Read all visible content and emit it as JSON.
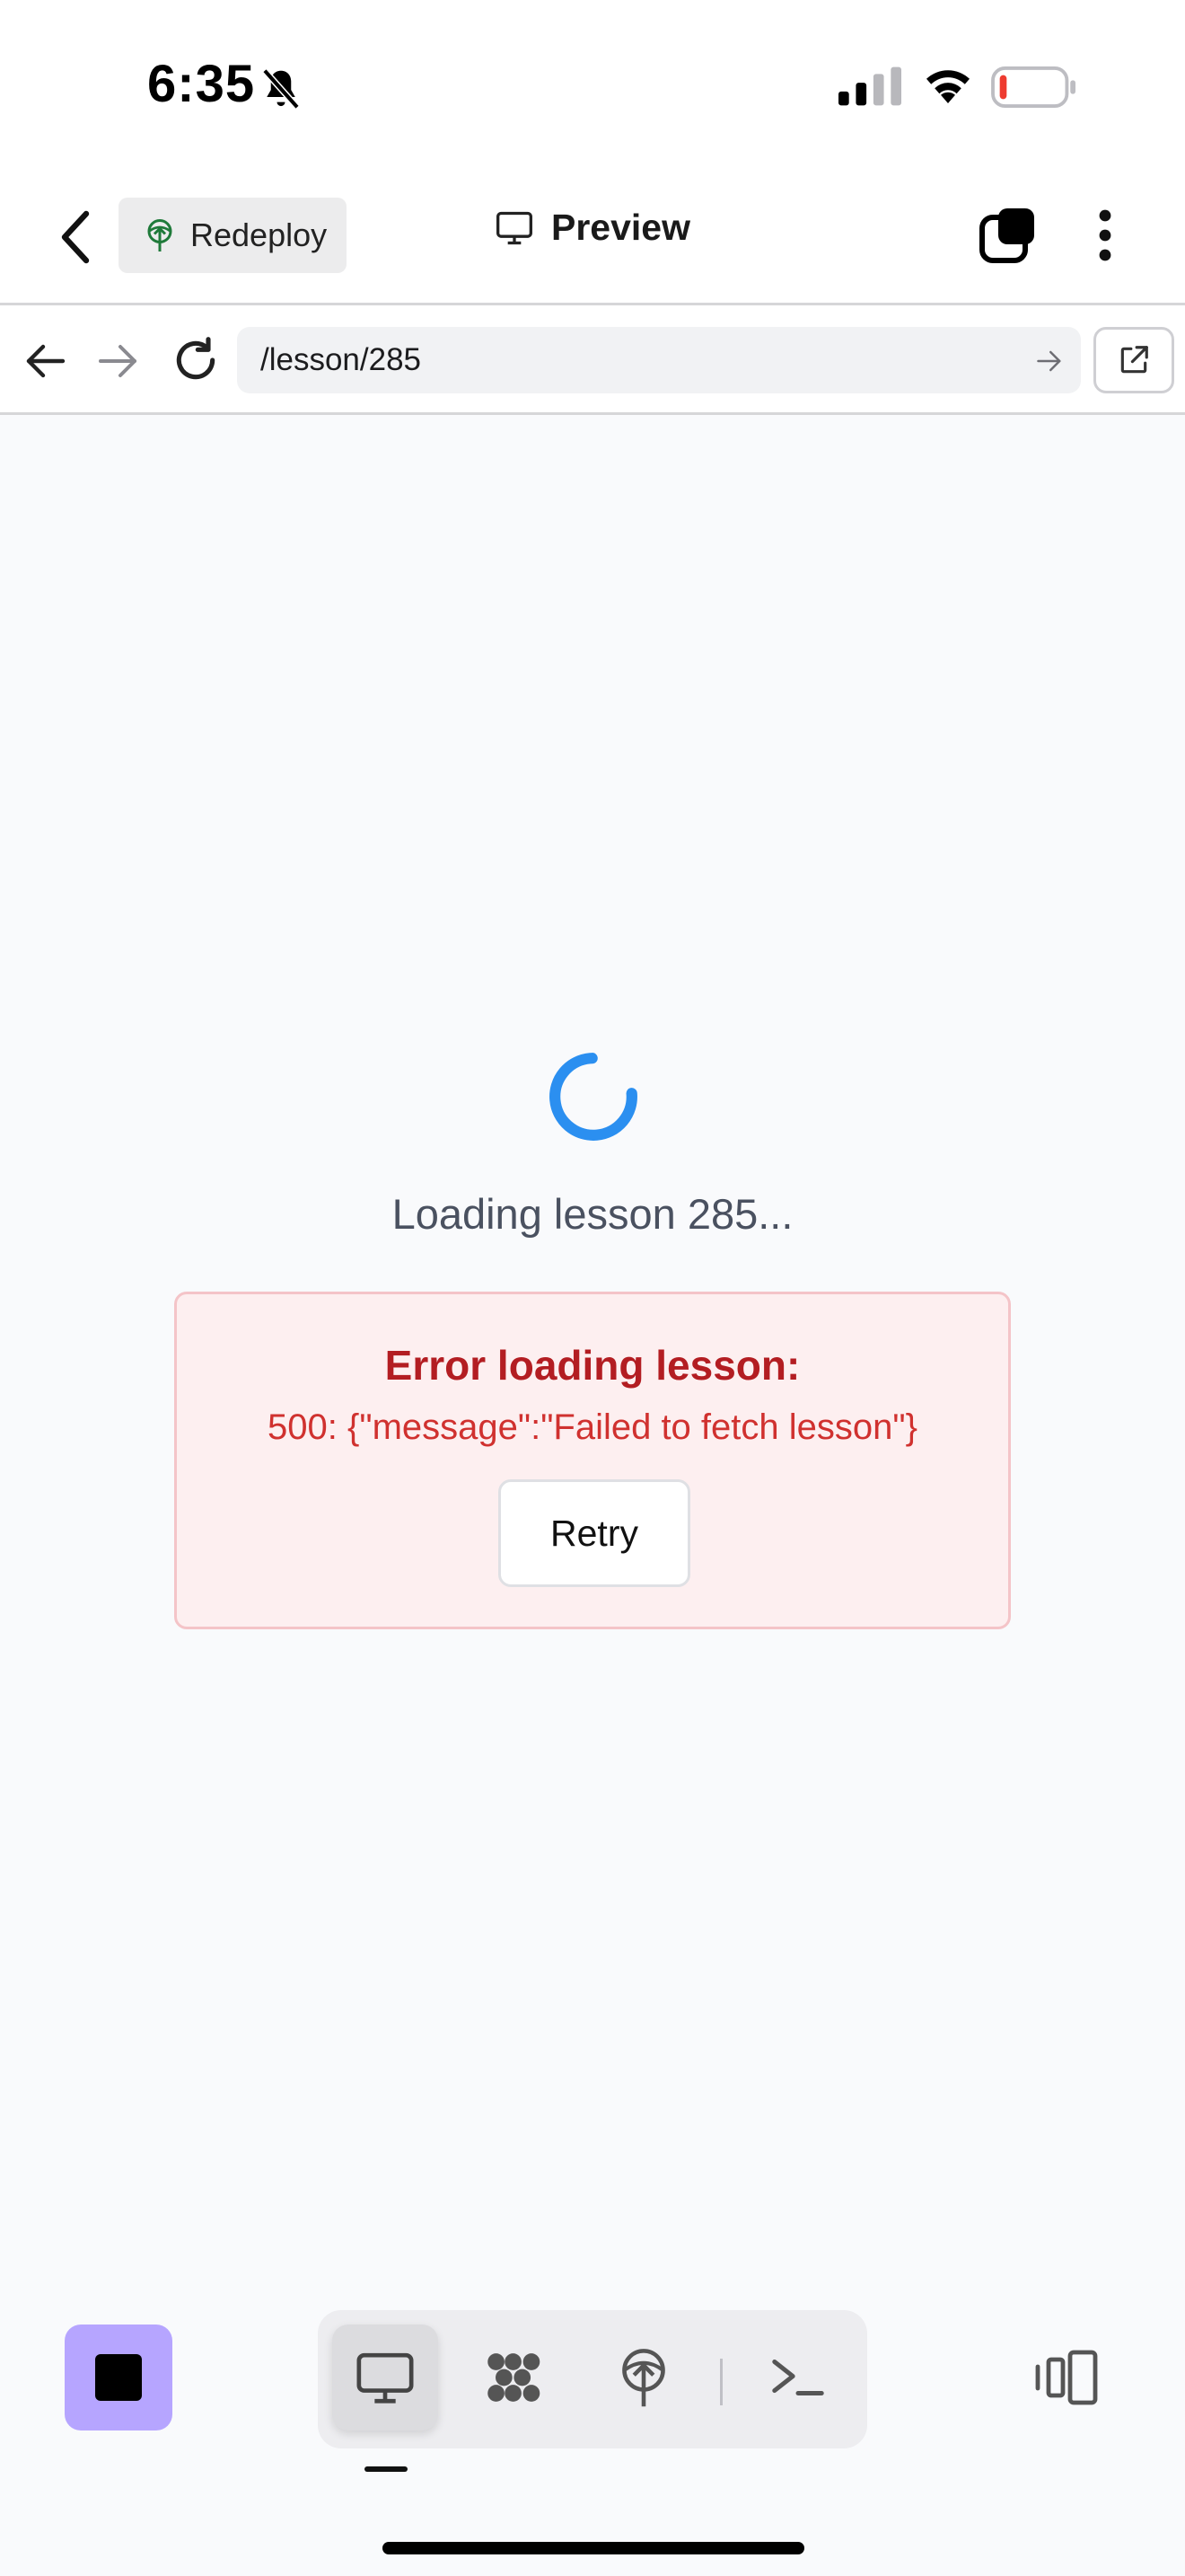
{
  "status_bar": {
    "time": "6:35",
    "icons": [
      "bell-slash-icon",
      "cellular-signal-icon",
      "wifi-icon",
      "battery-low-icon"
    ]
  },
  "app_bar": {
    "back_icon": "chevron-left-icon",
    "redeploy_label": "Redeploy",
    "redeploy_icon": "deploy-tree-icon",
    "title": "Preview",
    "title_icon": "monitor-icon",
    "right_icons": [
      "tabs-icon",
      "more-vertical-icon"
    ]
  },
  "browser_bar": {
    "url": "/lesson/285",
    "icons": [
      "arrow-left-icon",
      "arrow-right-icon",
      "reload-icon",
      "go-arrow-icon",
      "open-external-icon"
    ]
  },
  "content": {
    "loading_text": "Loading lesson 285...",
    "error_title": "Error loading lesson:",
    "error_message": "500: {\"message\":\"Failed to fetch lesson\"}",
    "retry_label": "Retry"
  },
  "bottom_bar": {
    "tools": [
      {
        "name": "preview",
        "icon": "monitor-icon",
        "active": true
      },
      {
        "name": "agent",
        "icon": "agent-blob-icon",
        "active": false
      },
      {
        "name": "deploy",
        "icon": "deploy-tree-icon",
        "active": false
      },
      {
        "name": "shell",
        "icon": "terminal-icon",
        "active": false
      }
    ],
    "right_icon": "panel-toggle-icon"
  },
  "colors": {
    "accent_purple": "#b6a5ff",
    "spinner_blue": "#2b8ff0",
    "error_red": "#b31d22",
    "error_bg": "#fdeff0"
  }
}
